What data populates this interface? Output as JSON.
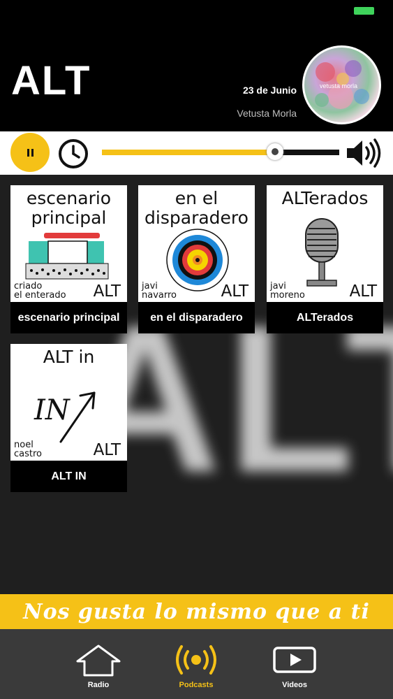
{
  "header": {
    "logo": "ALT"
  },
  "now_playing": {
    "date": "23 de Junio",
    "artist": "Vetusta Morla",
    "cover_label": "vetusta morla"
  },
  "player": {
    "progress": 0.73
  },
  "watermark": "ALT",
  "podcasts": [
    {
      "art_title_1": "escenario",
      "art_title_2": "principal",
      "author_1": "criado",
      "author_2": "el enterado",
      "alt": "ALT",
      "label": "escenario principal"
    },
    {
      "art_title_1": "en el",
      "art_title_2": "disparadero",
      "author_1": "javi",
      "author_2": "navarro",
      "alt": "ALT",
      "label": "en el disparadero"
    },
    {
      "art_title_1": "ALTerados",
      "art_title_2": "",
      "author_1": "javi",
      "author_2": "moreno",
      "alt": "ALT",
      "label": "ALTerados"
    },
    {
      "art_title_1": "ALT in",
      "art_title_2": "",
      "author_1": "noel",
      "author_2": "castro",
      "alt": "ALT",
      "label": "ALT IN",
      "art_word": "IN"
    }
  ],
  "banner": {
    "text": "Nos gusta lo mismo que a ti"
  },
  "tabs": [
    {
      "label": "Radio",
      "icon": "house-icon",
      "color": "#ffffff"
    },
    {
      "label": "Podcasts",
      "icon": "broadcast-icon",
      "color": "#f5c117"
    },
    {
      "label": "Videos",
      "icon": "play-icon",
      "color": "#ffffff"
    }
  ],
  "colors": {
    "accent": "#f5c117",
    "background": "#1f1f1f",
    "header": "#000000"
  }
}
